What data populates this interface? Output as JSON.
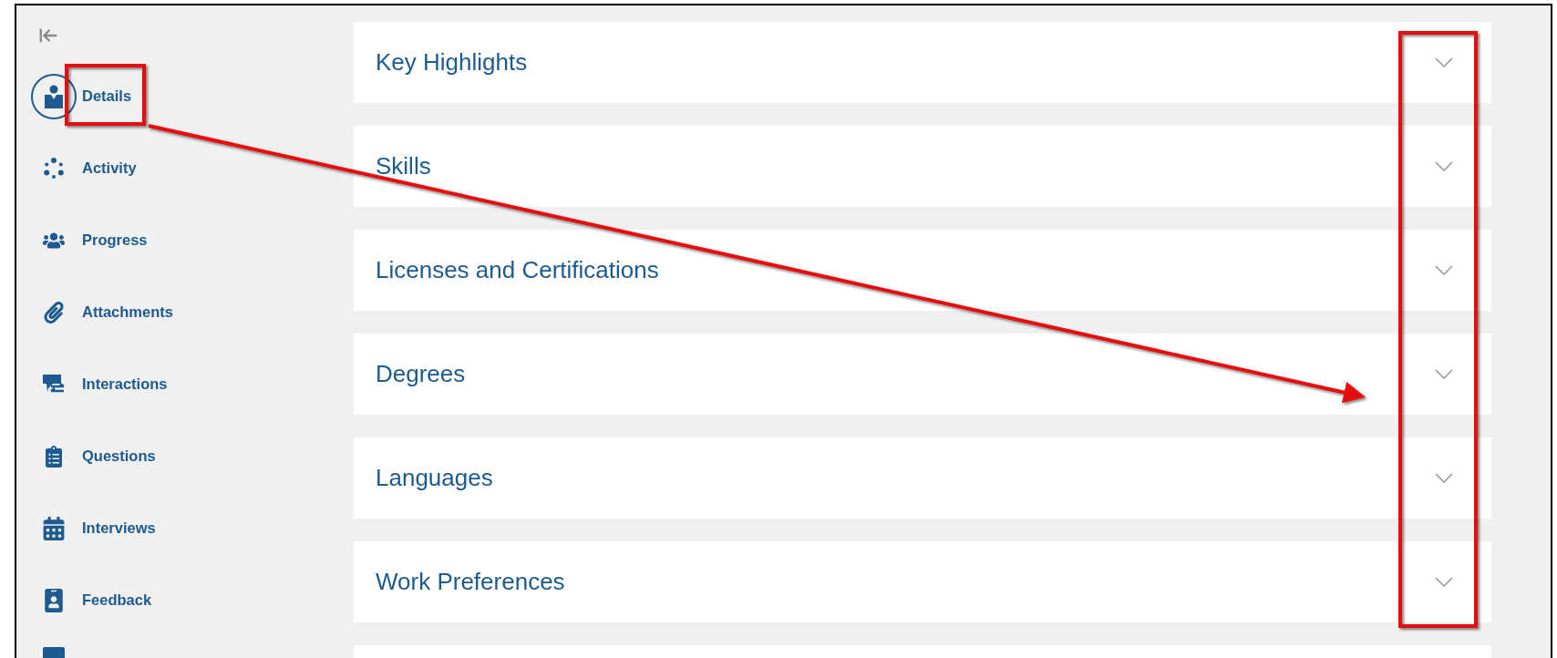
{
  "sidebar": {
    "items": [
      {
        "label": "Details",
        "selected": true
      },
      {
        "label": "Activity",
        "selected": false
      },
      {
        "label": "Progress",
        "selected": false
      },
      {
        "label": "Attachments",
        "selected": false
      },
      {
        "label": "Interactions",
        "selected": false
      },
      {
        "label": "Questions",
        "selected": false
      },
      {
        "label": "Interviews",
        "selected": false
      },
      {
        "label": "Feedback",
        "selected": false
      }
    ]
  },
  "sections": [
    {
      "title": "Key Highlights",
      "expanded": false
    },
    {
      "title": "Skills",
      "expanded": false
    },
    {
      "title": "Licenses and Certifications",
      "expanded": false
    },
    {
      "title": "Degrees",
      "expanded": false
    },
    {
      "title": "Languages",
      "expanded": false
    },
    {
      "title": "Work Preferences",
      "expanded": false
    }
  ]
}
